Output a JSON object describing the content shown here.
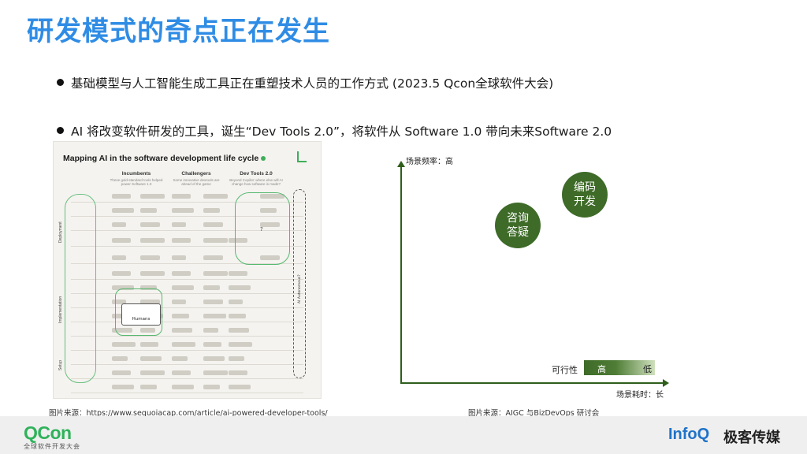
{
  "title": "研发模式的奇点正在发生",
  "bullets": [
    "基础模型与人工智能生成工具正在重塑技术人员的工作方式  (2023.5 Qcon全球软件大会)",
    "AI 将改变软件研发的工具，诞生“Dev Tools 2.0”，将软件从 Software 1.0 带向未来Software 2.0"
  ],
  "left_figure": {
    "heading": "Mapping AI in the software development life cycle",
    "columns": [
      "Incumbents",
      "Challengers",
      "Dev Tools 2.0"
    ],
    "column_notes": [
      "These gold-standard tools helped power Software 1.0",
      "Some innovative devtools are ahead of the game",
      "Beyond Copilot: where else will AI change how software is made?"
    ],
    "groups": [
      "Deployment",
      "Implementation",
      "Setup"
    ],
    "humans_label": "Humans",
    "question_mark": "?",
    "ai_side_label": "AI Autonomous?"
  },
  "quadrant": {
    "y_axis_label": "场景频率：高",
    "x_axis_label": "场景耗时：长",
    "bubbles": [
      {
        "label": "编码\n开发",
        "color": "#3e6b28"
      },
      {
        "label": "咨询\n答疑",
        "color": "#3e6b28"
      }
    ],
    "feasibility": {
      "label": "可行性",
      "high": "高",
      "low": "低"
    }
  },
  "sources": {
    "left": "图片来源：https://www.sequoiacap.com/article/ai-powered-developer-tools/",
    "right": "图片来源：AIGC 与BizDevOps 研讨会"
  },
  "footer": {
    "qcon_logo": "QCon",
    "qcon_sub": "全球软件开发大会",
    "infoq_logo": "InfoQ",
    "infoq_cn": "极客传媒"
  },
  "colors": {
    "title": "#2f8ce5",
    "bubble": "#3e6b28",
    "qcon": "#2fb25b",
    "infoq": "#1f73c8"
  }
}
